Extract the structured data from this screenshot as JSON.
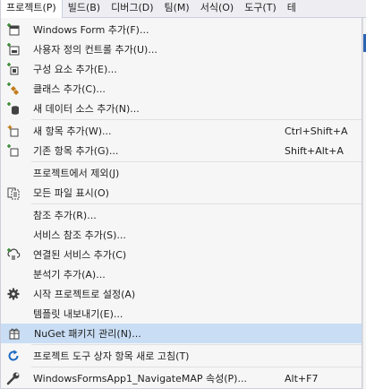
{
  "menubar": {
    "items": [
      {
        "label": "프로젝트(P)",
        "active": true
      },
      {
        "label": "빌드(B)"
      },
      {
        "label": "디버그(D)"
      },
      {
        "label": "팀(M)"
      },
      {
        "label": "서식(O)"
      },
      {
        "label": "도구(T)"
      },
      {
        "label": "테"
      }
    ]
  },
  "menu": {
    "groups": [
      [
        {
          "label": "Windows Form 추가(F)...",
          "icon": "add-form-icon"
        },
        {
          "label": "사용자 정의 컨트롤 추가(U)...",
          "icon": "add-user-control-icon"
        },
        {
          "label": "구성 요소 추가(E)...",
          "icon": "add-component-icon"
        },
        {
          "label": "클래스 추가(C)...",
          "icon": "add-class-icon"
        },
        {
          "label": "새 데이터 소스 추가(N)...",
          "icon": "add-data-source-icon"
        }
      ],
      [
        {
          "label": "새 항목 추가(W)...",
          "shortcut": "Ctrl+Shift+A",
          "icon": "new-item-icon"
        },
        {
          "label": "기존 항목 추가(G)...",
          "shortcut": "Shift+Alt+A",
          "icon": "existing-item-icon"
        }
      ],
      [
        {
          "label": "프로젝트에서 제외(J)",
          "icon": ""
        },
        {
          "label": "모든 파일 표시(O)",
          "icon": "show-all-files-icon"
        }
      ],
      [
        {
          "label": "참조 추가(R)...",
          "icon": ""
        },
        {
          "label": "서비스 참조 추가(S)...",
          "icon": ""
        },
        {
          "label": "연결된 서비스 추가(C)",
          "icon": "connected-service-icon"
        },
        {
          "label": "분석기 추가(A)...",
          "icon": ""
        },
        {
          "label": "시작 프로젝트로 설정(A)",
          "icon": "gear-icon"
        },
        {
          "label": "템플릿 내보내기(E)...",
          "icon": ""
        },
        {
          "label": "NuGet 패키지 관리(N)...",
          "icon": "nuget-package-icon",
          "highlighted": true
        }
      ],
      [
        {
          "label": "프로젝트 도구 상자 항목 새로 고침(T)",
          "icon": "refresh-icon"
        }
      ],
      [
        {
          "label": "WindowsFormsApp1_NavigateMAP 속성(P)...",
          "shortcut": "Alt+F7",
          "icon": "wrench-icon"
        }
      ]
    ]
  },
  "colors": {
    "highlight": "#c9def5",
    "menu_bg": "#f6f6f6",
    "menubar_bg": "#eeeef2",
    "accent": "#2c62b2"
  }
}
